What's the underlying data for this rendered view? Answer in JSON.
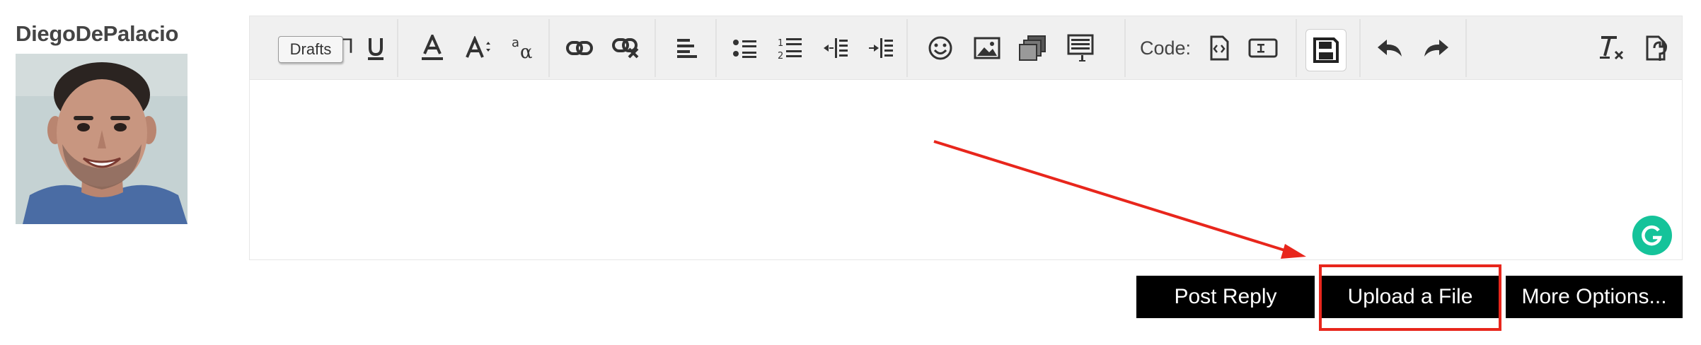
{
  "user": {
    "name": "DiegoDePalacio"
  },
  "toolbar": {
    "drafts_label": "Drafts",
    "code_label": "Code:",
    "groups": [
      {
        "name": "text-style",
        "buttons": [
          "underline-icon"
        ]
      },
      {
        "name": "font",
        "buttons": [
          "font-color-icon",
          "font-size-icon",
          "font-family-icon"
        ]
      },
      {
        "name": "links",
        "buttons": [
          "link-icon",
          "unlink-icon"
        ]
      },
      {
        "name": "alignment",
        "buttons": [
          "align-left-icon"
        ]
      },
      {
        "name": "lists",
        "buttons": [
          "bulleted-list-icon",
          "numbered-list-icon",
          "outdent-icon",
          "indent-icon"
        ]
      },
      {
        "name": "insert",
        "buttons": [
          "smilie-icon",
          "image-icon",
          "media-icon",
          "quote-icon"
        ]
      },
      {
        "name": "code",
        "buttons": [
          "code-block-icon",
          "inline-code-icon"
        ]
      },
      {
        "name": "drafts",
        "buttons": [
          "save-draft-icon"
        ]
      },
      {
        "name": "history",
        "buttons": [
          "undo-icon",
          "redo-icon"
        ]
      },
      {
        "name": "tools",
        "buttons": [
          "remove-format-icon",
          "toggle-bb-code-icon"
        ]
      }
    ]
  },
  "editor": {
    "content": ""
  },
  "actions": {
    "post_reply": "Post Reply",
    "upload_file": "Upload a File",
    "more_options": "More Options..."
  },
  "annotation": {
    "color": "#e8261c",
    "target": "Upload a File"
  },
  "colors": {
    "toolbar_bg": "#f0f0f0",
    "button_bg": "#000000",
    "button_text": "#ffffff",
    "grammarly": "#15c39a"
  }
}
